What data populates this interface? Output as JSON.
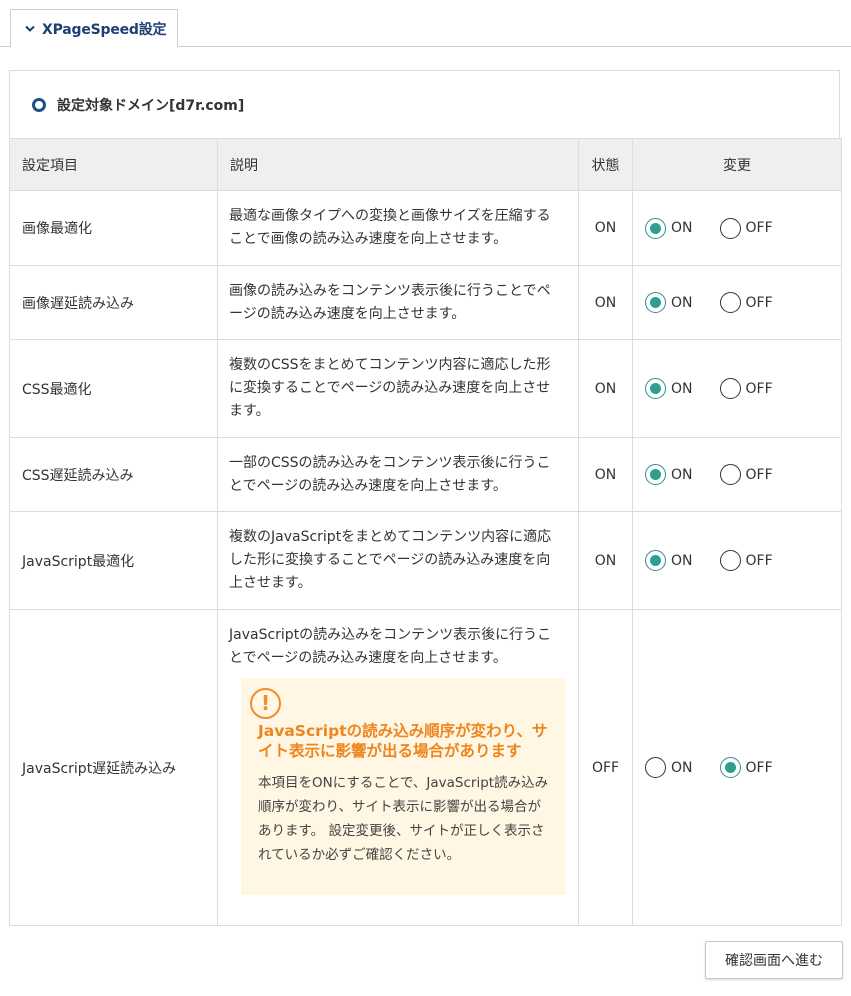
{
  "tab": {
    "title": "XPageSpeed設定"
  },
  "domain": {
    "title": "設定対象ドメイン[d7r.com]"
  },
  "table": {
    "headers": [
      "設定項目",
      "説明",
      "状態",
      "変更"
    ],
    "rows": [
      {
        "name": "画像最適化",
        "description": "最適な画像タイプへの変換と画像サイズを圧縮することで画像の読み込み速度を向上させます。",
        "state": "ON",
        "selected": "ON"
      },
      {
        "name": "画像遅延読み込み",
        "description": "画像の読み込みをコンテンツ表示後に行うことでページの読み込み速度を向上させます。",
        "state": "ON",
        "selected": "ON"
      },
      {
        "name": "CSS最適化",
        "description": "複数のCSSをまとめてコンテンツ内容に適応した形に変換することでページの読み込み速度を向上させます。",
        "state": "ON",
        "selected": "ON"
      },
      {
        "name": "CSS遅延読み込み",
        "description": "一部のCSSの読み込みをコンテンツ表示後に行うことでページの読み込み速度を向上させます。",
        "state": "ON",
        "selected": "ON"
      },
      {
        "name": "JavaScript最適化",
        "description": "複数のJavaScriptをまとめてコンテンツ内容に適応した形に変換することでページの読み込み速度を向上させます。",
        "state": "ON",
        "selected": "ON"
      },
      {
        "name": "JavaScript遅延読み込み",
        "description": "JavaScriptの読み込みをコンテンツ表示後に行うことでページの読み込み速度を向上させます。",
        "state": "OFF",
        "selected": "OFF"
      }
    ],
    "radio_on_label": "ON",
    "radio_off_label": "OFF"
  },
  "warning": {
    "icon": "exclamation-icon",
    "title": "JavaScriptの読み込み順序が変わり、サイト表示に影響が出る場合があります",
    "body": "本項目をONにすることで、JavaScript読み込み順序が変わり、サイト表示に影響が出る場合があります。 設定変更後、サイトが正しく表示されているか必ずご確認ください。"
  },
  "confirm_button": "確認画面へ進む",
  "colors": {
    "accent": "#2f9e90",
    "warning": "#ee8620",
    "tab_text": "#1f3f74",
    "header_bg": "#efefef"
  }
}
